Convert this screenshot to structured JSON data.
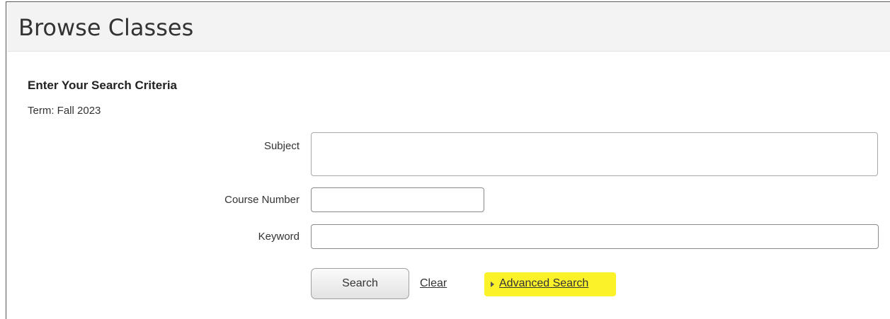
{
  "header": {
    "title": "Browse Classes"
  },
  "form": {
    "section_title": "Enter Your Search Criteria",
    "term": "Term: Fall 2023",
    "fields": {
      "subject": {
        "label": "Subject",
        "value": ""
      },
      "course_number": {
        "label": "Course Number",
        "value": ""
      },
      "keyword": {
        "label": "Keyword",
        "value": ""
      }
    },
    "actions": {
      "search_label": "Search",
      "clear_label": "Clear",
      "advanced_label": "Advanced Search"
    }
  },
  "colors": {
    "highlight": "#fcf22a",
    "header_bg": "#f3f3f3"
  },
  "icons": {
    "advanced_toggle": "caret-right-icon"
  }
}
